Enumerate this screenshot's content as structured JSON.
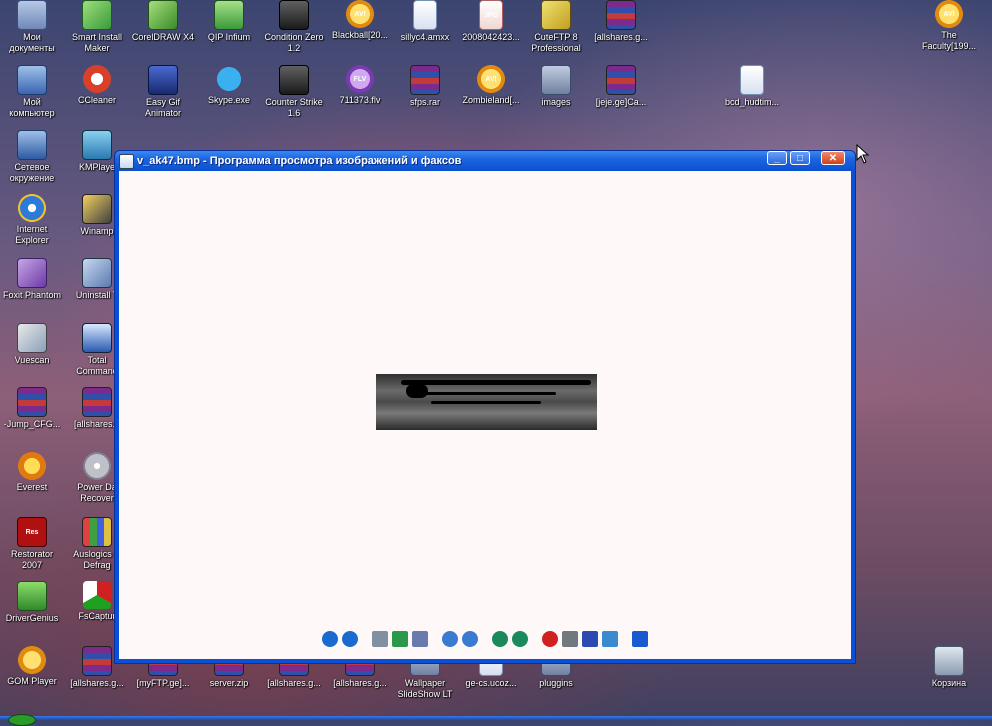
{
  "desktop_icons": [
    {
      "label": "Мои\nдокументы",
      "icon": "my-documents-icon",
      "kind": "folder"
    },
    {
      "label": "Мой\nкомпьютер",
      "icon": "my-computer-icon",
      "kind": "computer"
    },
    {
      "label": "Сетевое\nокружение",
      "icon": "network-icon",
      "kind": "network"
    },
    {
      "label": "Internet\nExplorer",
      "icon": "internet-explorer-icon",
      "kind": "ie"
    },
    {
      "label": "Foxit Phantom",
      "icon": "foxit-phantom-icon",
      "kind": "foxit"
    },
    {
      "label": "Vuescan",
      "icon": "vuescan-icon",
      "kind": "vuescan"
    },
    {
      "label": "-Jump_CFG...",
      "icon": "winrar-archive-icon",
      "kind": "winrar"
    },
    {
      "label": "Everest",
      "icon": "everest-icon",
      "kind": "everest"
    },
    {
      "label": "Restorator\n2007",
      "icon": "restorator-icon",
      "kind": "restorator",
      "badge": "Res"
    },
    {
      "label": "DriverGenius",
      "icon": "drivergenius-icon",
      "kind": "drivergenius"
    },
    {
      "label": "GOM Player",
      "icon": "gom-player-icon",
      "kind": "gom"
    },
    {
      "label": "Smart Install\nMaker",
      "icon": "smart-install-maker-icon",
      "kind": "smartinstall"
    },
    {
      "label": "CCleaner",
      "icon": "ccleaner-icon",
      "kind": "ccleaner"
    },
    {
      "label": "KMPlaye",
      "icon": "kmplayer-icon",
      "kind": "kmplayer"
    },
    {
      "label": "Winamp",
      "icon": "winamp-icon",
      "kind": "winamp"
    },
    {
      "label": "Uninstall T",
      "icon": "uninstall-tool-icon",
      "kind": "uninstall"
    },
    {
      "label": "Total\nCommand",
      "icon": "total-commander-icon",
      "kind": "totalcmd"
    },
    {
      "label": "[allshares.g",
      "icon": "winrar-archive-icon",
      "kind": "winrar"
    },
    {
      "label": "Power Da\nRecover",
      "icon": "power-data-recovery-icon",
      "kind": "powerdata"
    },
    {
      "label": "Auslogics D\nDefrag",
      "icon": "auslogics-defrag-icon",
      "kind": "auslogics"
    },
    {
      "label": "FsCaptur",
      "icon": "fscapture-icon",
      "kind": "fscapture"
    },
    {
      "label": "[allshares.g...",
      "icon": "winrar-archive-icon",
      "kind": "winrar"
    },
    {
      "label": "CorelDRAW X4",
      "icon": "coreldraw-icon",
      "kind": "corel"
    },
    {
      "label": "Easy Gif\nAnimator",
      "icon": "easy-gif-animator-icon",
      "kind": "easygif"
    },
    {
      "label": "[myFTP.ge]...",
      "icon": "winrar-archive-icon",
      "kind": "winrar"
    },
    {
      "label": "QIP Infium",
      "icon": "qip-infium-icon",
      "kind": "qip"
    },
    {
      "label": "Skype.exe",
      "icon": "skype-icon",
      "kind": "skype"
    },
    {
      "label": "server.zip",
      "icon": "winrar-archive-icon",
      "kind": "winrar"
    },
    {
      "label": "Condition Zero\n1.2",
      "icon": "counter-strike-icon",
      "kind": "cs"
    },
    {
      "label": "Counter Strike\n1.6",
      "icon": "counter-strike-icon",
      "kind": "cs"
    },
    {
      "label": "[allshares.g...",
      "icon": "winrar-archive-icon",
      "kind": "winrar"
    },
    {
      "label": "Blackball[20...",
      "icon": "avi-file-icon",
      "kind": "avi",
      "badge": "AVI"
    },
    {
      "label": "711373.flv",
      "icon": "flv-file-icon",
      "kind": "flv",
      "badge": "FLV"
    },
    {
      "label": "[allshares.g...",
      "icon": "winrar-archive-icon",
      "kind": "winrar"
    },
    {
      "label": "sillyc4.amxx",
      "icon": "document-file-icon",
      "kind": "doc"
    },
    {
      "label": "sfps.rar",
      "icon": "winrar-archive-icon",
      "kind": "winrar"
    },
    {
      "label": "Wallpaper\nSlideShow LT",
      "icon": "wallpaper-slideshow-icon",
      "kind": "images"
    },
    {
      "label": "2008042423...",
      "icon": "jpg-file-icon",
      "kind": "jpg",
      "badge": "JPG"
    },
    {
      "label": "Zombieland[...",
      "icon": "avi-file-icon",
      "kind": "avi",
      "badge": "AVI"
    },
    {
      "label": "ge-cs.ucoz...",
      "icon": "document-file-icon",
      "kind": "doc"
    },
    {
      "label": "CuteFTP 8\nProfessional",
      "icon": "cuteftp-icon",
      "kind": "cuteftp"
    },
    {
      "label": "images",
      "icon": "images-folder-icon",
      "kind": "images"
    },
    {
      "label": "pluggins",
      "icon": "folder-icon",
      "kind": "images"
    },
    {
      "label": "[allshares.g...",
      "icon": "winrar-archive-icon",
      "kind": "winrar"
    },
    {
      "label": "[jeje.ge]Ca...",
      "icon": "winrar-archive-icon",
      "kind": "winrar"
    },
    {
      "label": "bcd_hudtim...",
      "icon": "document-file-icon",
      "kind": "doc"
    },
    {
      "label": "The\nFaculty[199...",
      "icon": "avi-file-icon",
      "kind": "avi",
      "badge": "AVI"
    },
    {
      "label": "Корзина",
      "icon": "recycle-bin-icon",
      "kind": "recycle"
    }
  ],
  "window": {
    "title": "v_ak47.bmp - Программа просмотра изображений и факсов",
    "minimize_label": "_",
    "maximize_label": "□",
    "close_label": "✕"
  },
  "toolbar": {
    "buttons": [
      {
        "name": "previous-image-button",
        "icon": "previous-icon",
        "color": "#1a6ad0"
      },
      {
        "name": "next-image-button",
        "icon": "next-icon",
        "color": "#1a6ad0"
      },
      {
        "name": "best-fit-button",
        "icon": "best-fit-icon",
        "color": "#8090a0"
      },
      {
        "name": "actual-size-button",
        "icon": "actual-size-icon",
        "color": "#2a9a4a"
      },
      {
        "name": "slideshow-button",
        "icon": "slideshow-icon",
        "color": "#6a7ab0"
      },
      {
        "name": "zoom-in-button",
        "icon": "zoom-in-icon",
        "color": "#3a7ad0"
      },
      {
        "name": "zoom-out-button",
        "icon": "zoom-out-icon",
        "color": "#3a7ad0"
      },
      {
        "name": "rotate-clockwise-button",
        "icon": "rotate-clockwise-icon",
        "color": "#1a8a5a"
      },
      {
        "name": "rotate-counterclockwise-button",
        "icon": "rotate-counterclockwise-icon",
        "color": "#1a8a5a"
      },
      {
        "name": "delete-button",
        "icon": "delete-icon",
        "color": "#d02020"
      },
      {
        "name": "print-button",
        "icon": "print-icon",
        "color": "#707880"
      },
      {
        "name": "save-button",
        "icon": "save-icon",
        "color": "#2a4ab0"
      },
      {
        "name": "edit-button",
        "icon": "edit-icon",
        "color": "#3a8ad0"
      },
      {
        "name": "help-button",
        "icon": "help-icon",
        "color": "#1a5ad0"
      }
    ]
  }
}
